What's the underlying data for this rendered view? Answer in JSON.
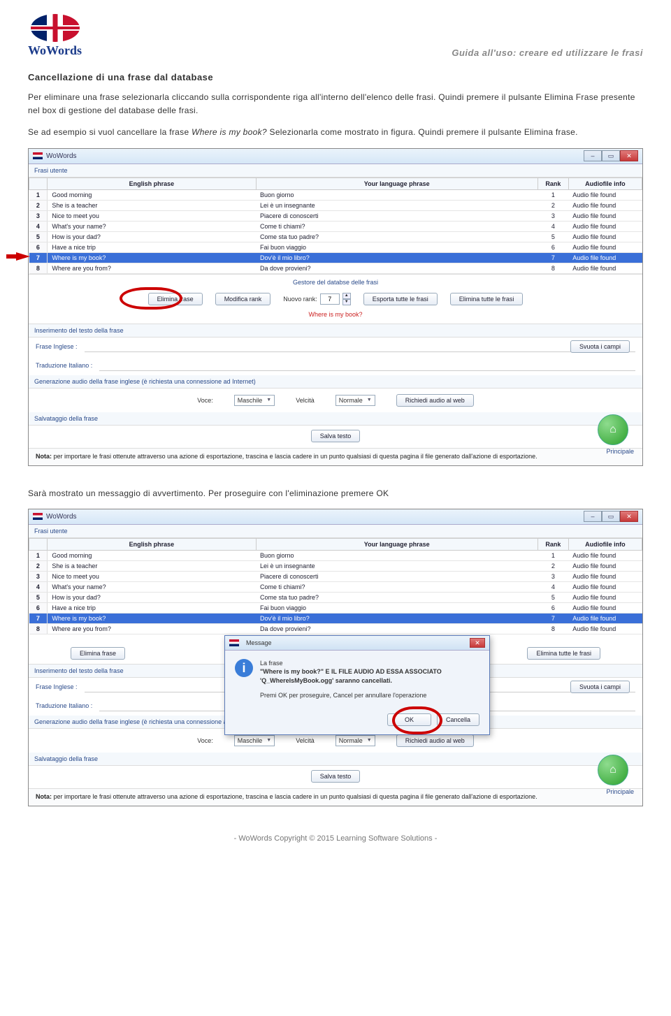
{
  "header": {
    "logo_text": "WoWords",
    "doc_title": "Guida all'uso: creare ed utilizzare le frasi"
  },
  "section_title": "Cancellazione di una frase dal database",
  "paragraphs": {
    "p1": "Per eliminare una frase selezionarla cliccando sulla corrispondente riga all'interno dell'elenco delle frasi. Quindi premere il pulsante Elimina Frase presente nel box di gestione del database delle frasi.",
    "p2a": "Se ad esempio si vuol cancellare la frase ",
    "p2b": "Where is my book?",
    "p2c": " Selezionarla come mostrato in figura. Quindi premere il pulsante Elimina frase.",
    "p3": "Sarà mostrato un messaggio di avvertimento. Per proseguire con l'eliminazione premere OK"
  },
  "app": {
    "win_title": "WoWords",
    "panel_user_phrases": "Frasi utente",
    "columns": {
      "english": "English phrase",
      "your_lang": "Your language phrase",
      "rank": "Rank",
      "audio": "Audiofile info"
    },
    "rows": [
      {
        "n": "1",
        "en": "Good morning",
        "yl": "Buon giorno",
        "rank": "1",
        "af": "Audio file found"
      },
      {
        "n": "2",
        "en": "She is a teacher",
        "yl": "Lei è un insegnante",
        "rank": "2",
        "af": "Audio file found"
      },
      {
        "n": "3",
        "en": "Nice to meet you",
        "yl": "Piacere di conoscerti",
        "rank": "3",
        "af": "Audio file found"
      },
      {
        "n": "4",
        "en": "What's your name?",
        "yl": "Come ti chiami?",
        "rank": "4",
        "af": "Audio file found"
      },
      {
        "n": "5",
        "en": "How is your dad?",
        "yl": "Come sta tuo padre?",
        "rank": "5",
        "af": "Audio file found"
      },
      {
        "n": "6",
        "en": "Have a nice trip",
        "yl": "Fai buon viaggio",
        "rank": "6",
        "af": "Audio file found"
      },
      {
        "n": "7",
        "en": "Where is my book?",
        "yl": "Dov'è il mio libro?",
        "rank": "7",
        "af": "Audio file found"
      },
      {
        "n": "8",
        "en": "Where are you from?",
        "yl": "Da dove provieni?",
        "rank": "8",
        "af": "Audio file found"
      }
    ],
    "gestore_label": "Gestore del databse delle frasi",
    "buttons": {
      "elimina_frase": "Elimina frase",
      "modifica_rank": "Modifica rank",
      "nuovo_rank_label": "Nuovo rank:",
      "nuovo_rank_value": "7",
      "esporta": "Esporta tutte le frasi",
      "elimina_tutte": "Elimina tutte le frasi",
      "svuota_campi": "Svuota i campi",
      "richiedi_audio": "Richiedi audio al web",
      "salva_testo": "Salva testo",
      "principale": "Principale",
      "ok": "OK",
      "cancella": "Cancella"
    },
    "current_phrase": "Where is my book?",
    "panel_insert": "Inserimento del testo della frase",
    "label_en": "Frase Inglese :",
    "label_tr": "Traduzione Italiano :",
    "panel_gen": "Generazione audio della frase inglese (è richiesta una connessione ad Internet)",
    "voce_label": "Voce:",
    "voce_value": "Maschile",
    "velocita_label": "Velcità",
    "velocita_value": "Normale",
    "panel_save": "Salvataggio della frase",
    "nota_bold": "Nota:",
    "nota_text": " per importare le frasi ottenute attraverso una azione di esportazione, trascina e lascia cadere in un punto qualsiasi di questa pagina il file generato dall'azione di esportazione.",
    "dialog": {
      "title": "Message",
      "line1": "La frase",
      "line2": "\"Where is my book?\" E IL FILE AUDIO AD ESSA ASSOCIATO",
      "line3": "'Q_WhereIsMyBook.ogg' saranno cancellati.",
      "line4": "Premi OK per proseguire, Cancel per annullare l'operazione"
    }
  },
  "footer": "- WoWords Copyright © 2015 Learning Software Solutions -"
}
